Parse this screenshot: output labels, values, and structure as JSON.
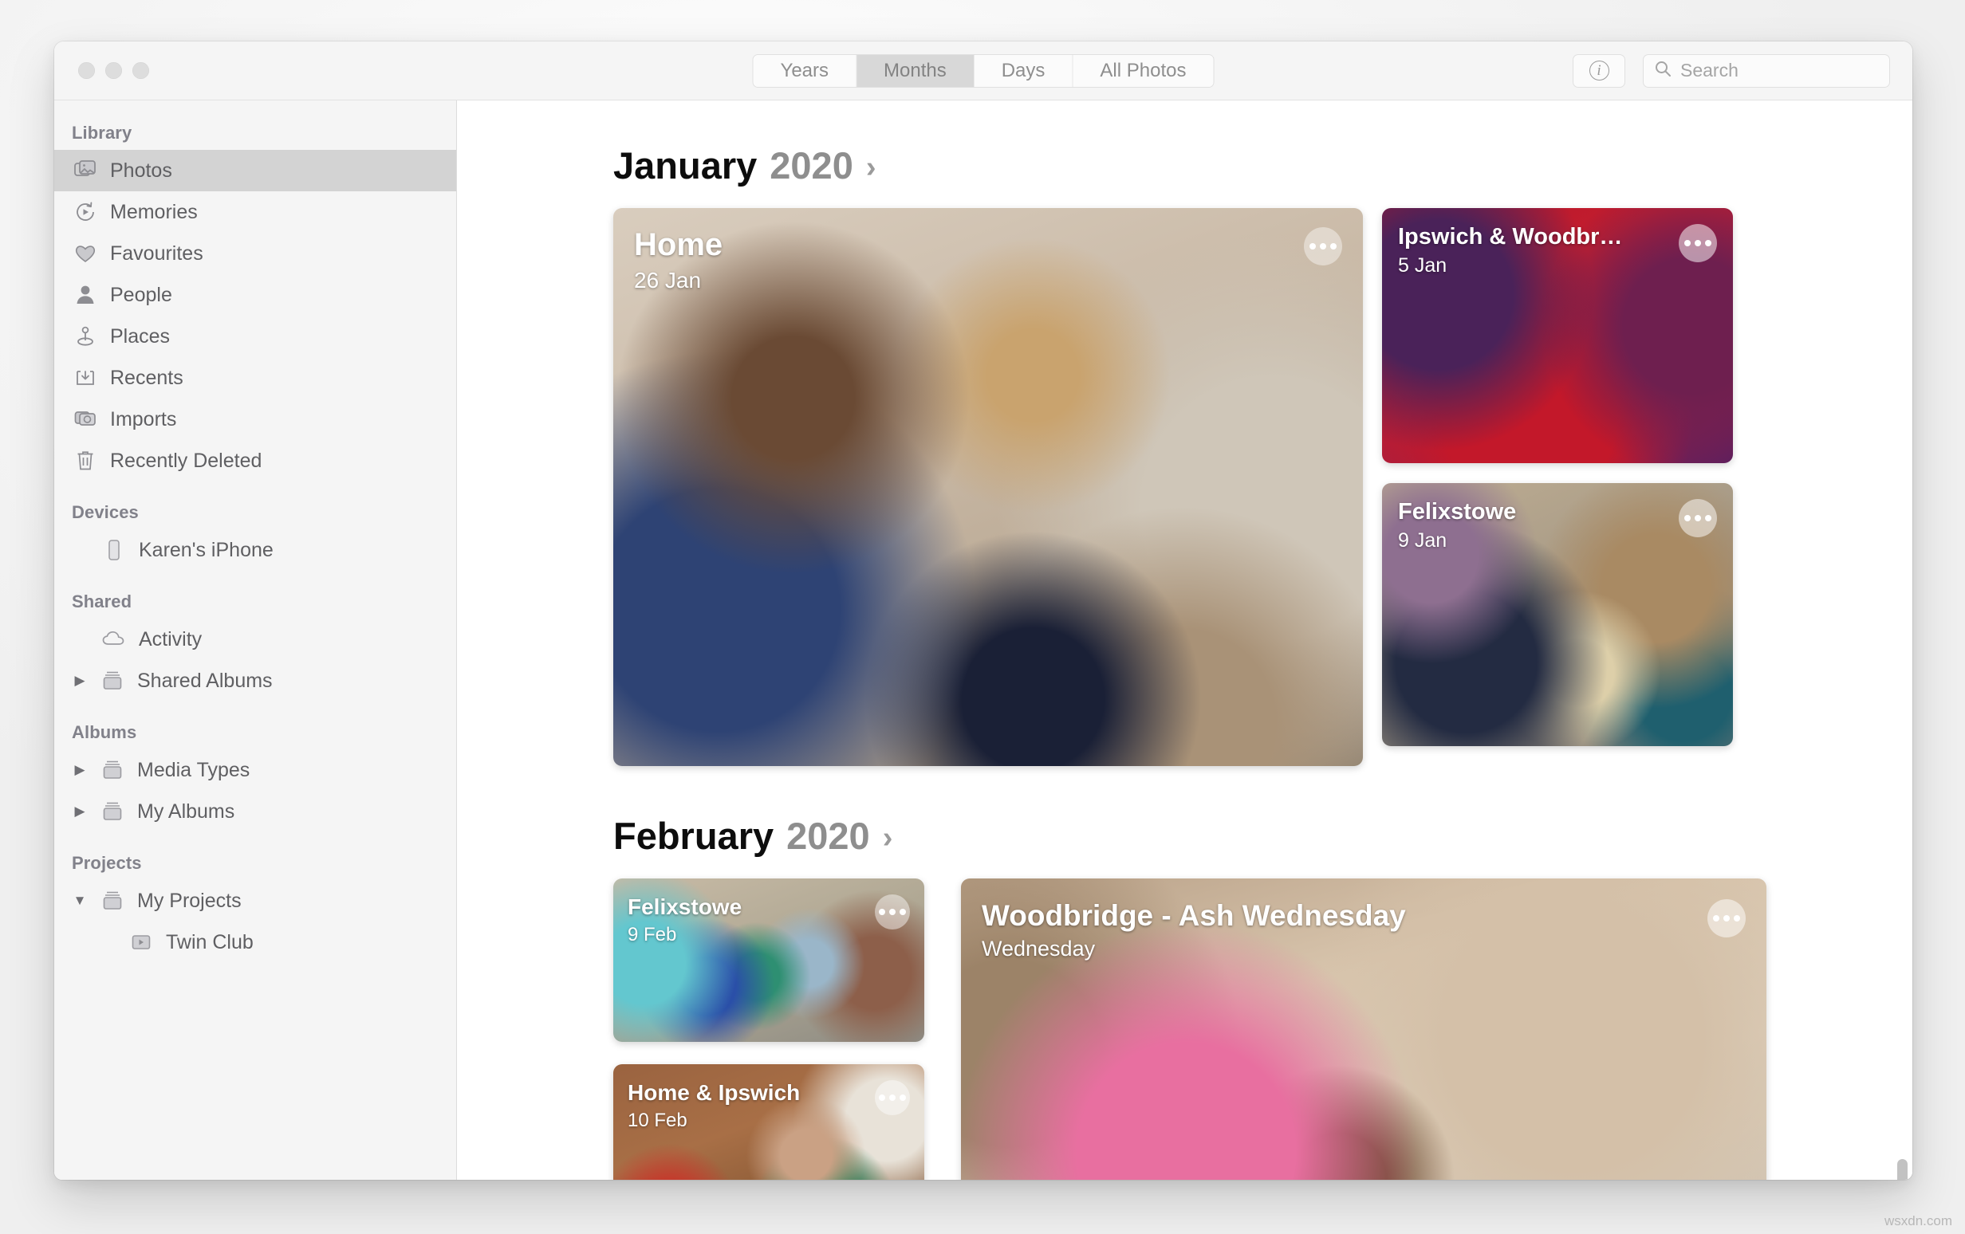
{
  "window": {
    "traffic_lights": [
      "close",
      "minimize",
      "zoom"
    ]
  },
  "toolbar": {
    "segments": [
      {
        "label": "Years",
        "active": false
      },
      {
        "label": "Months",
        "active": true
      },
      {
        "label": "Days",
        "active": false
      },
      {
        "label": "All Photos",
        "active": false
      }
    ],
    "info_label": "i",
    "search": {
      "placeholder": "Search",
      "value": ""
    }
  },
  "sidebar": {
    "groups": [
      {
        "title": "Library",
        "items": [
          {
            "label": "Photos",
            "icon": "photos-icon",
            "selected": true
          },
          {
            "label": "Memories",
            "icon": "memories-icon",
            "selected": false
          },
          {
            "label": "Favourites",
            "icon": "heart-icon",
            "selected": false
          },
          {
            "label": "People",
            "icon": "person-icon",
            "selected": false
          },
          {
            "label": "Places",
            "icon": "pin-icon",
            "selected": false
          },
          {
            "label": "Recents",
            "icon": "download-tray-icon",
            "selected": false
          },
          {
            "label": "Imports",
            "icon": "camera-folder-icon",
            "selected": false
          },
          {
            "label": "Recently Deleted",
            "icon": "trash-icon",
            "selected": false
          }
        ]
      },
      {
        "title": "Devices",
        "items": [
          {
            "label": "Karen's iPhone",
            "icon": "iphone-icon",
            "selected": false
          }
        ]
      },
      {
        "title": "Shared",
        "items": [
          {
            "label": "Activity",
            "icon": "cloud-icon",
            "selected": false
          },
          {
            "label": "Shared Albums",
            "icon": "album-stack-icon",
            "disclosure": "collapsed",
            "selected": false
          }
        ]
      },
      {
        "title": "Albums",
        "items": [
          {
            "label": "Media Types",
            "icon": "album-stack-icon",
            "disclosure": "collapsed",
            "selected": false
          },
          {
            "label": "My Albums",
            "icon": "album-stack-icon",
            "disclosure": "collapsed",
            "selected": false
          }
        ]
      },
      {
        "title": "Projects",
        "items": [
          {
            "label": "My Projects",
            "icon": "album-stack-icon",
            "disclosure": "expanded",
            "selected": false
          },
          {
            "label": "Twin Club",
            "icon": "project-icon",
            "selected": false,
            "child": true
          }
        ]
      }
    ]
  },
  "content": {
    "sections": [
      {
        "month": "January",
        "year": "2020",
        "chevron": "›",
        "cards": [
          {
            "title": "Home",
            "subtitle": "26 Jan",
            "more": "more-options"
          },
          {
            "title": "Ipswich & Woodbr…",
            "subtitle": "5 Jan",
            "more": "more-options"
          },
          {
            "title": "Felixstowe",
            "subtitle": "9 Jan",
            "more": "more-options"
          }
        ]
      },
      {
        "month": "February",
        "year": "2020",
        "chevron": "›",
        "cards": [
          {
            "title": "Felixstowe",
            "subtitle": "9 Feb",
            "more": "more-options"
          },
          {
            "title": "Woodbridge - Ash Wednesday",
            "subtitle": "Wednesday",
            "more": "more-options"
          },
          {
            "title": "Home & Ipswich",
            "subtitle": "10 Feb",
            "more": "more-options"
          }
        ]
      }
    ]
  },
  "watermark": "wsxdn.com",
  "colors": {
    "window_chrome": "#f5f5f5",
    "sidebar_bg": "#f5f5f5",
    "selection": "#d3d3d3",
    "segment_active": "#d8d8d8",
    "text_primary": "#0d0d0d",
    "text_secondary": "#8e8e8e"
  }
}
